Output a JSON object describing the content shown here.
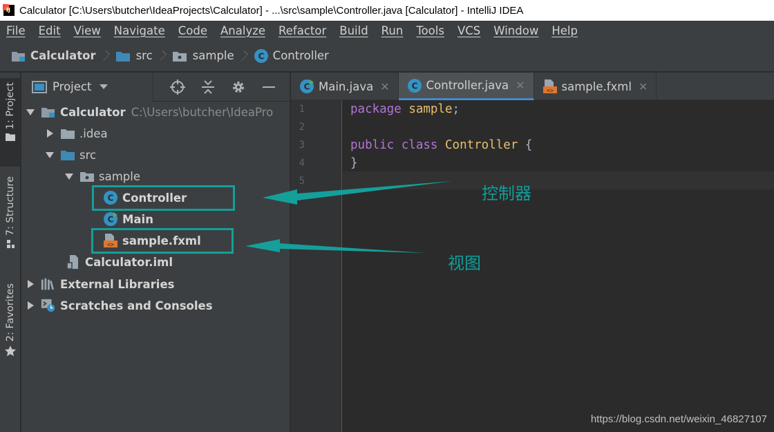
{
  "window": {
    "title": "Calculator [C:\\Users\\butcher\\IdeaProjects\\Calculator] - ...\\src\\sample\\Controller.java [Calculator] - IntelliJ IDEA"
  },
  "menu": [
    "File",
    "Edit",
    "View",
    "Navigate",
    "Code",
    "Analyze",
    "Refactor",
    "Build",
    "Run",
    "Tools",
    "VCS",
    "Window",
    "Help"
  ],
  "breadcrumb": [
    "Calculator",
    "src",
    "sample",
    "Controller"
  ],
  "tool_strip": {
    "project": "1: Project",
    "structure": "7: Structure",
    "favorites": "2: Favorites"
  },
  "project_panel": {
    "view_selector": "Project",
    "tree": [
      {
        "label": "Calculator",
        "path": "C:\\Users\\butcher\\IdeaPro"
      },
      {
        "label": ".idea"
      },
      {
        "label": "src"
      },
      {
        "label": "sample"
      },
      {
        "label": "Controller"
      },
      {
        "label": "Main"
      },
      {
        "label": "sample.fxml"
      },
      {
        "label": "Calculator.iml"
      },
      {
        "label": "External Libraries"
      },
      {
        "label": "Scratches and Consoles"
      }
    ]
  },
  "editor": {
    "tabs": [
      {
        "label": "Main.java",
        "close": "✕"
      },
      {
        "label": "Controller.java",
        "close": "✕"
      },
      {
        "label": "sample.fxml",
        "close": "✕"
      }
    ],
    "line_numbers": [
      "1",
      "2",
      "3",
      "4",
      "5"
    ],
    "code": {
      "line1_kw": "package",
      "line1_name": "sample",
      "line1_end": ";",
      "line3_kw1": "public",
      "line3_kw2": "class",
      "line3_name": "Controller",
      "line3_brace": "{",
      "line4_brace": "}"
    }
  },
  "annotations": {
    "controller_note": "控制器",
    "view_note": "视图",
    "accent_color": "#159f9a"
  },
  "watermark": "https://blog.csdn.net/weixin_46827107",
  "colors": {
    "background": "#2b2b2b",
    "panel": "#3c3f41",
    "keyword": "#b574d6",
    "identifier": "#e6c06d"
  }
}
